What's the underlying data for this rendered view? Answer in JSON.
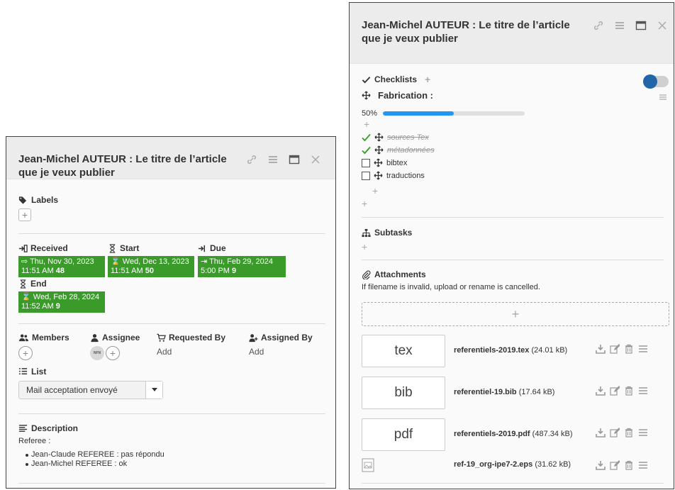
{
  "cardA": {
    "title": "Jean-Michel AUTEUR : Le titre de l’article que je veux publier",
    "labels": {
      "title": "Labels"
    },
    "dates": {
      "received": {
        "label": "Received",
        "line1": "Thu, Nov 30, 2023",
        "time": "11:51 AM",
        "num": "48"
      },
      "start": {
        "label": "Start",
        "line1": "Wed, Dec 13, 2023",
        "time": "11:51 AM",
        "num": "50"
      },
      "due": {
        "label": "Due",
        "line1": "Thu, Feb 29, 2024",
        "time": "5:00 PM",
        "num": "9"
      },
      "end": {
        "label": "End",
        "line1": "Wed, Feb 28, 2024",
        "time": "11:52 AM",
        "num": "9"
      }
    },
    "people": {
      "members": "Members",
      "assignee": "Assignee",
      "assignee_initials": "NFN",
      "requested_by": "Requested By",
      "requested_by_value": "Add",
      "assigned_by": "Assigned By",
      "assigned_by_value": "Add"
    },
    "list": {
      "title": "List",
      "selected": "Mail acceptation envoyé"
    },
    "description": {
      "title": "Description",
      "intro": "Referee :",
      "items": [
        "Jean-Claude REFEREE : pas répondu",
        "Jean-Michel REFEREE : ok"
      ]
    }
  },
  "cardB": {
    "title": "Jean-Michel AUTEUR : Le titre de l’article que je veux publier",
    "checklists": {
      "title": "Checklists",
      "toggle_on": true,
      "list_name": "Fabrication :",
      "progress_label": "50%",
      "progress": 0.5,
      "items": [
        {
          "text": "sources Tex",
          "done": true
        },
        {
          "text": "métadonnées",
          "done": true
        },
        {
          "text": "bibtex",
          "done": false
        },
        {
          "text": "traductions",
          "done": false
        }
      ]
    },
    "subtasks": {
      "title": "Subtasks"
    },
    "attachments": {
      "title": "Attachments",
      "note": "If filename is invalid, upload or rename is cancelled.",
      "files": [
        {
          "thumb": "tex",
          "name": "referentiels-2019.tex",
          "size": "(24.01 kB)"
        },
        {
          "thumb": "bib",
          "name": "referentiel-19.bib",
          "size": "(17.64 kB)"
        },
        {
          "thumb": "pdf",
          "name": "referentiels-2019.pdf",
          "size": "(487.34 kB)"
        },
        {
          "thumb": "",
          "name": "ref-19_org-ipe7-2.eps",
          "size": "(31.62 kB)"
        }
      ]
    }
  },
  "colors": {
    "date_green": "#3a9a2a",
    "progress_blue": "#2196f3",
    "toggle_knob": "#2266aa",
    "check_green": "#3a9a2a"
  }
}
